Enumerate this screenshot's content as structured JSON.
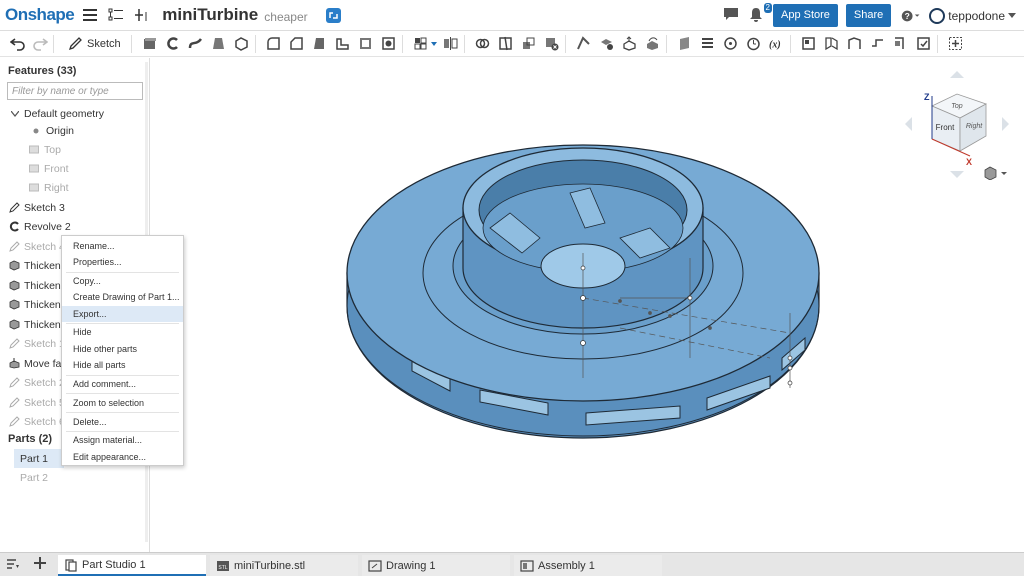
{
  "app": {
    "logo": "Onshape",
    "document_title": "miniTurbine",
    "workspace": "cheaper"
  },
  "top_right": {
    "notification_count": "2",
    "app_store": "App Store",
    "share": "Share",
    "username": "teppodone"
  },
  "toolbar": {
    "sketch_label": "Sketch"
  },
  "features": {
    "title": "Features (33)",
    "filter_placeholder": "Filter by name or type",
    "default_geometry": "Default geometry",
    "origin": "Origin",
    "top": "Top",
    "front": "Front",
    "right": "Right",
    "items": [
      {
        "label": "Sketch 3"
      },
      {
        "label": "Revolve 2"
      },
      {
        "label": "Sketch 4"
      },
      {
        "label": "Thicken"
      },
      {
        "label": "Thicken"
      },
      {
        "label": "Thicken"
      },
      {
        "label": "Thicken"
      },
      {
        "label": "Sketch 1"
      },
      {
        "label": "Move fac"
      },
      {
        "label": "Sketch 2"
      },
      {
        "label": "Sketch 5"
      },
      {
        "label": "Sketch 6"
      }
    ],
    "parts_title": "Parts (2)",
    "parts": [
      "Part 1",
      "Part 2"
    ]
  },
  "context_menu": {
    "items": [
      "Rename...",
      "Properties...",
      "Copy...",
      "Create Drawing of Part 1...",
      "Export...",
      "Hide",
      "Hide other parts",
      "Hide all parts",
      "Add comment...",
      "Zoom to selection",
      "Delete...",
      "Assign material...",
      "Edit appearance..."
    ]
  },
  "view_cube": {
    "top": "Top",
    "front": "Front",
    "right": "Right",
    "axis_z": "Z",
    "axis_x": "X"
  },
  "tabs": [
    "Part Studio 1",
    "miniTurbine.stl",
    "Drawing 1",
    "Assembly 1"
  ]
}
